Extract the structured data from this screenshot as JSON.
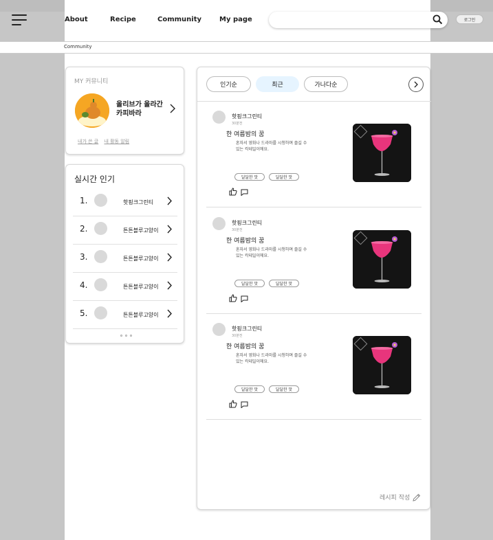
{
  "header": {
    "nav": [
      "About",
      "Recipe",
      "Community",
      "My page"
    ],
    "search": {
      "placeholder": ""
    },
    "login_label": "로그인"
  },
  "breadcrumb": "Community",
  "my_community": {
    "title": "MY 커뮤니티",
    "name": "올리브가 올라간 카피바라",
    "links": [
      "내가 쓴 글",
      "내 활동 알림"
    ]
  },
  "popular": {
    "title": "실시간 인기",
    "items": [
      {
        "rank": "1.",
        "name": "핫핑크그린티"
      },
      {
        "rank": "2.",
        "name": "튼튼블루고양이"
      },
      {
        "rank": "3.",
        "name": "튼튼블루고양이"
      },
      {
        "rank": "4.",
        "name": "튼튼블루고양이"
      },
      {
        "rank": "5.",
        "name": "튼튼블루고양이"
      }
    ]
  },
  "feed": {
    "tabs": [
      {
        "label": "인기순",
        "active": false
      },
      {
        "label": "최근",
        "active": true
      },
      {
        "label": "가나다순",
        "active": false
      }
    ],
    "posts": [
      {
        "author": "핫핑크그린티",
        "time": "30분전",
        "title": "한 여름밤의 꿈",
        "desc": "혼자서 영화나 드라마를 시청하며 즐길 수 있는 칵테일이에요.",
        "tags": [
          "달달한 맛",
          "달달한 맛"
        ]
      },
      {
        "author": "핫핑크그린티",
        "time": "30분전",
        "title": "한 여름밤의 꿈",
        "desc": "혼자서 영화나 드라마를 시청하며 즐길 수 있는 칵테일이에요.",
        "tags": [
          "달달한 맛",
          "달달한 맛"
        ]
      },
      {
        "author": "핫핑크그린티",
        "time": "30분전",
        "title": "한 여름밤의 꿈",
        "desc": "혼자서 영화나 드라마를 시청하며 즐길 수 있는 칵테일이에요.",
        "tags": [
          "달달한 맛",
          "달달한 맛"
        ]
      }
    ],
    "write_label": "레시피 작성"
  },
  "colors": {
    "active_tab": "#e6f4ff",
    "cocktail": "#e8357c"
  }
}
